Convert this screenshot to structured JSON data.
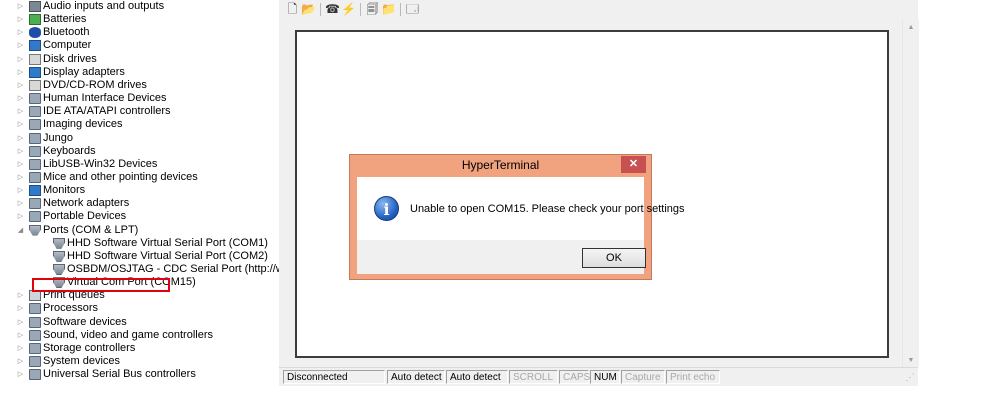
{
  "device_tree": {
    "items": [
      {
        "label": "Audio inputs and outputs",
        "icon": "speaker-icon",
        "expand": "collapsed",
        "level": 0
      },
      {
        "label": "Batteries",
        "icon": "battery-icon",
        "expand": "collapsed",
        "level": 0
      },
      {
        "label": "Bluetooth",
        "icon": "bluetooth-icon",
        "expand": "collapsed",
        "level": 0
      },
      {
        "label": "Computer",
        "icon": "computer-icon",
        "expand": "collapsed",
        "level": 0
      },
      {
        "label": "Disk drives",
        "icon": "disk-drive-icon",
        "expand": "collapsed",
        "level": 0
      },
      {
        "label": "Display adapters",
        "icon": "display-adapter-icon",
        "expand": "collapsed",
        "level": 0
      },
      {
        "label": "DVD/CD-ROM drives",
        "icon": "dvd-drive-icon",
        "expand": "collapsed",
        "level": 0
      },
      {
        "label": "Human Interface Devices",
        "icon": "hid-icon",
        "expand": "collapsed",
        "level": 0
      },
      {
        "label": "IDE ATA/ATAPI controllers",
        "icon": "ide-controller-icon",
        "expand": "collapsed",
        "level": 0
      },
      {
        "label": "Imaging devices",
        "icon": "camera-icon",
        "expand": "collapsed",
        "level": 0
      },
      {
        "label": "Jungo",
        "icon": "jungo-icon",
        "expand": "collapsed",
        "level": 0
      },
      {
        "label": "Keyboards",
        "icon": "keyboard-icon",
        "expand": "collapsed",
        "level": 0
      },
      {
        "label": "LibUSB-Win32 Devices",
        "icon": "usb-device-icon",
        "expand": "collapsed",
        "level": 0
      },
      {
        "label": "Mice and other pointing devices",
        "icon": "mouse-icon",
        "expand": "collapsed",
        "level": 0
      },
      {
        "label": "Monitors",
        "icon": "monitor-icon",
        "expand": "collapsed",
        "level": 0
      },
      {
        "label": "Network adapters",
        "icon": "network-adapter-icon",
        "expand": "collapsed",
        "level": 0
      },
      {
        "label": "Portable Devices",
        "icon": "portable-device-icon",
        "expand": "collapsed",
        "level": 0
      },
      {
        "label": "Ports (COM & LPT)",
        "icon": "port-icon",
        "expand": "expanded",
        "level": 0
      },
      {
        "label": "HHD Software Virtual Serial Port (COM1)",
        "icon": "serial-port-icon",
        "expand": "none",
        "level": 1
      },
      {
        "label": "HHD Software Virtual Serial Port (COM2)",
        "icon": "serial-port-icon",
        "expand": "none",
        "level": 1
      },
      {
        "label": "OSBDM/OSJTAG - CDC Serial Port (http://www.pemicro.c",
        "icon": "serial-port-icon",
        "expand": "none",
        "level": 1
      },
      {
        "label": "Virtual Com Port (COM15)",
        "icon": "serial-port-icon",
        "expand": "none",
        "level": 1
      },
      {
        "label": "Print queues",
        "icon": "printer-icon",
        "expand": "collapsed",
        "level": 0
      },
      {
        "label": "Processors",
        "icon": "processor-icon",
        "expand": "collapsed",
        "level": 0
      },
      {
        "label": "Software devices",
        "icon": "software-device-icon",
        "expand": "collapsed",
        "level": 0
      },
      {
        "label": "Sound, video and game controllers",
        "icon": "sound-icon",
        "expand": "collapsed",
        "level": 0
      },
      {
        "label": "Storage controllers",
        "icon": "storage-controller-icon",
        "expand": "collapsed",
        "level": 0
      },
      {
        "label": "System devices",
        "icon": "system-device-icon",
        "expand": "collapsed",
        "level": 0
      },
      {
        "label": "Universal Serial Bus controllers",
        "icon": "usb-controller-icon",
        "expand": "collapsed",
        "level": 0
      }
    ],
    "highlight_color": "#e3000f"
  },
  "toolbar": {
    "buttons": [
      "new-icon",
      "open-icon",
      "dial-icon",
      "disconnect-icon",
      "send-icon",
      "receive-icon",
      "properties-icon"
    ]
  },
  "status_bar": {
    "connection": "Disconnected",
    "detect1": "Auto detect",
    "detect2": "Auto detect",
    "scroll": "SCROLL",
    "caps": "CAPS",
    "num": "NUM",
    "capture": "Capture",
    "print_echo": "Print echo"
  },
  "dialog": {
    "title": "HyperTerminal",
    "close_glyph": "✕",
    "message": "Unable to open COM15. Please check your port settings",
    "ok_label": "OK",
    "icon": "info-icon",
    "title_color": "#f1a27f"
  }
}
